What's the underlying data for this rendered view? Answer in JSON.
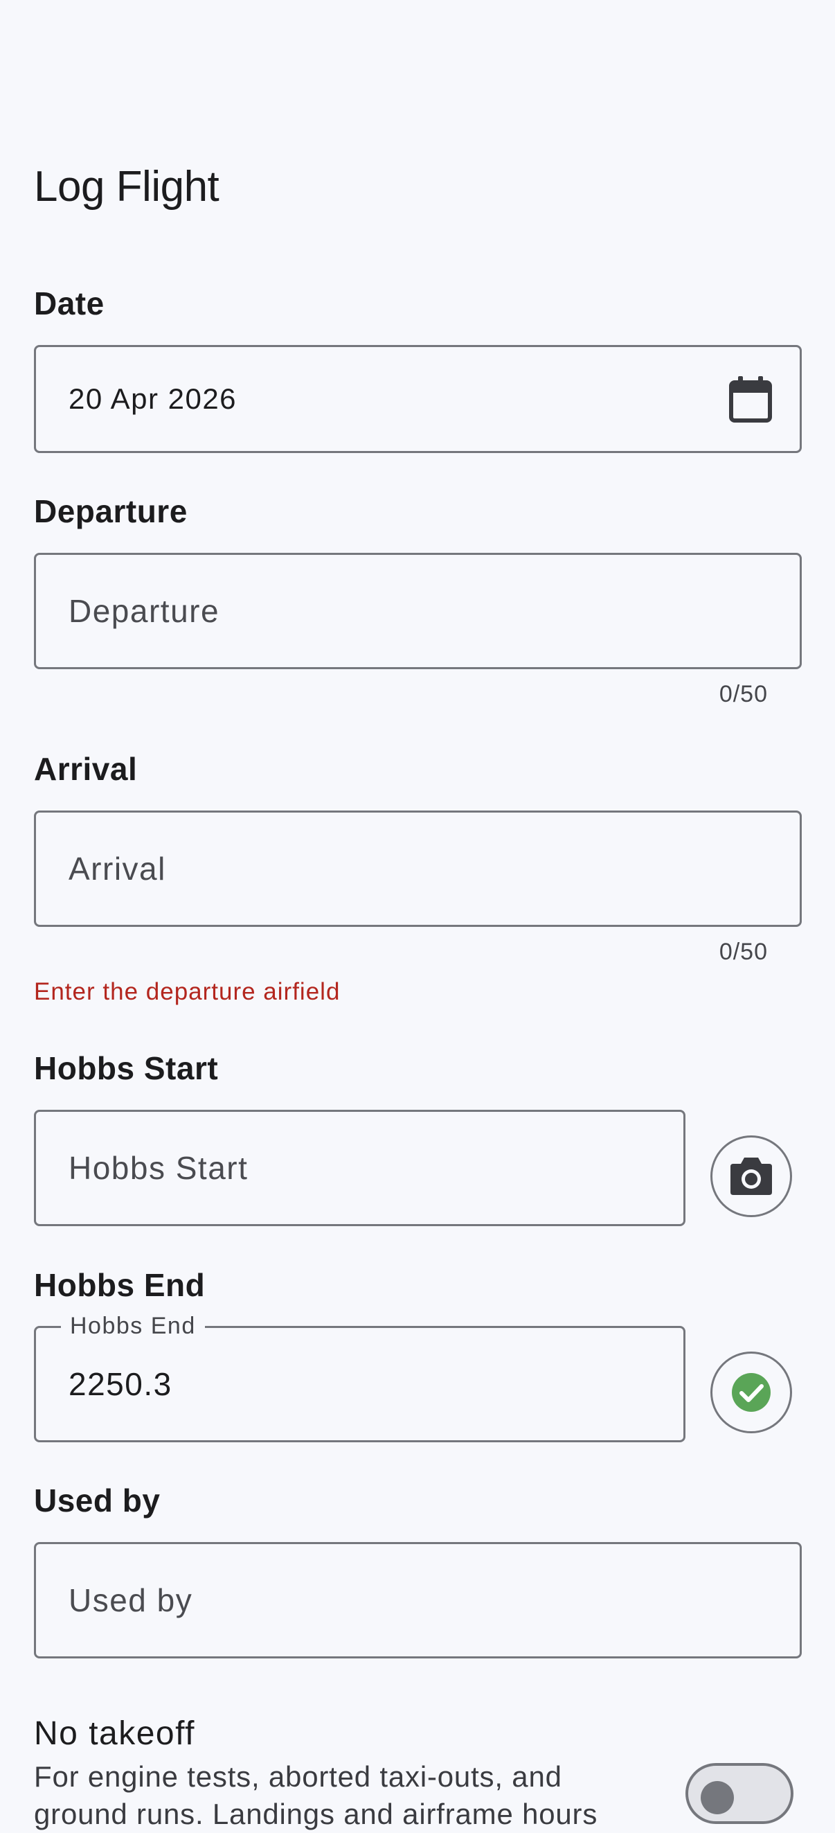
{
  "page": {
    "title": "Log Flight"
  },
  "date": {
    "label": "Date",
    "value": "20 Apr 2026",
    "icon": "calendar-icon"
  },
  "departure": {
    "label": "Departure",
    "placeholder": "Departure",
    "counter": "0/50"
  },
  "arrival": {
    "label": "Arrival",
    "placeholder": "Arrival",
    "counter": "0/50",
    "error": "Enter the departure airfield"
  },
  "hobbs_start": {
    "label": "Hobbs Start",
    "placeholder": "Hobbs Start",
    "icon": "camera-icon"
  },
  "hobbs_end": {
    "label": "Hobbs End",
    "floating_label": "Hobbs End",
    "value": "2250.3",
    "icon": "check-circle-icon"
  },
  "used_by": {
    "label": "Used by",
    "placeholder": "Used by"
  },
  "no_takeoff": {
    "title": "No takeoff",
    "description": "For engine tests, aborted taxi-outs, and ground runs. Landings and airframe hours",
    "enabled": false
  },
  "colors": {
    "background": "#f7f8fc",
    "error": "#b3261e",
    "success": "#5aa557",
    "outline": "#75777d"
  }
}
